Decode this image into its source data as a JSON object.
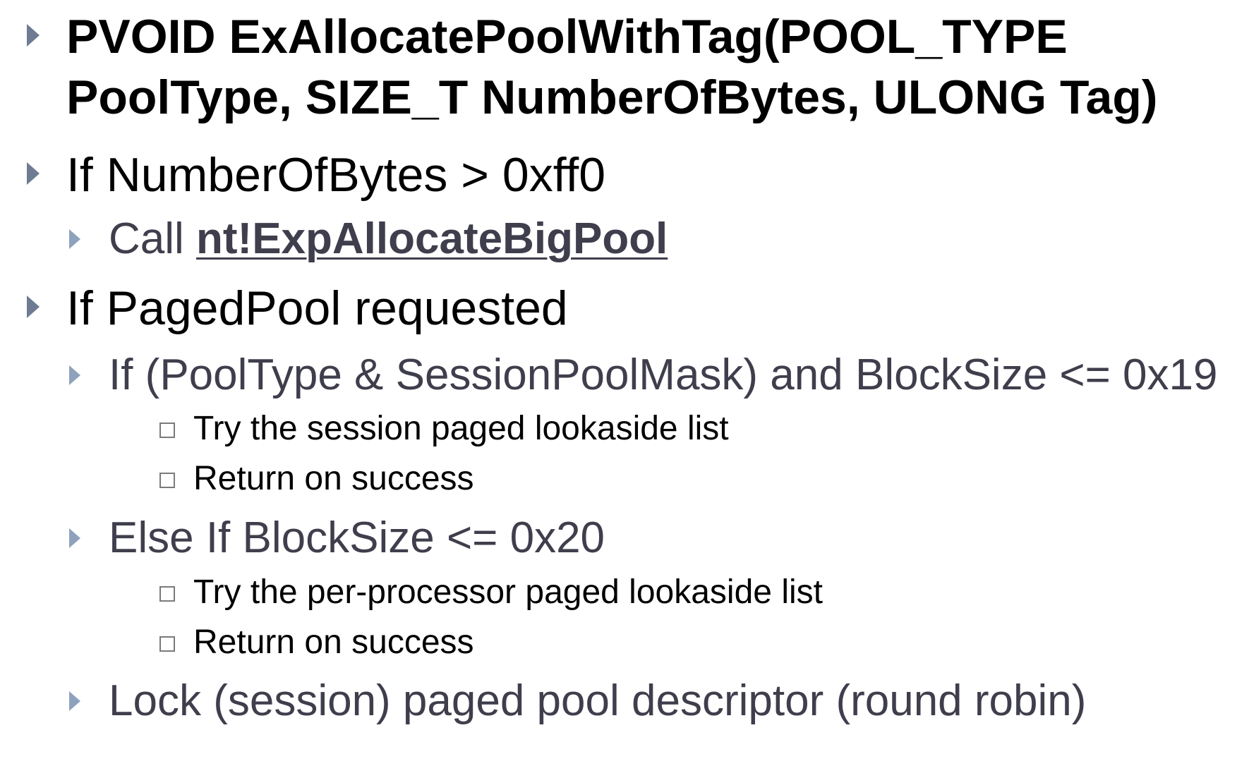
{
  "slide": {
    "items": [
      {
        "level": 1,
        "line1": "PVOID ExAllocatePoolWithTag(POOL_TYPE",
        "line2": "PoolType, SIZE_T NumberOfBytes, ULONG Tag)"
      },
      {
        "level": 1,
        "text": "If NumberOfBytes > 0xff0"
      },
      {
        "level": 2,
        "prefix": "Call ",
        "link": "nt!ExpAllocateBigPool"
      },
      {
        "level": 1,
        "text": "If PagedPool requested"
      },
      {
        "level": 2,
        "text": "If (PoolType & SessionPoolMask) and BlockSize <= 0x19"
      },
      {
        "level": 3,
        "text": "Try the session paged lookaside list"
      },
      {
        "level": 3,
        "text": "Return on success"
      },
      {
        "level": 2,
        "text": "Else If BlockSize <= 0x20"
      },
      {
        "level": 3,
        "text": "Try the per-processor paged lookaside list"
      },
      {
        "level": 3,
        "text": "Return on success"
      },
      {
        "level": 2,
        "text": "Lock (session) paged pool descriptor (round robin)"
      }
    ]
  },
  "icons": {
    "level1_bullet": "triangle-bullet-icon",
    "level2_bullet": "triangle-bullet-icon",
    "level3_bullet": "square-bullet-icon"
  },
  "colors": {
    "level1_text": "#000000",
    "level2_text": "#3f3e4c",
    "level3_text": "#000000",
    "bullet": "#6d7b93"
  }
}
